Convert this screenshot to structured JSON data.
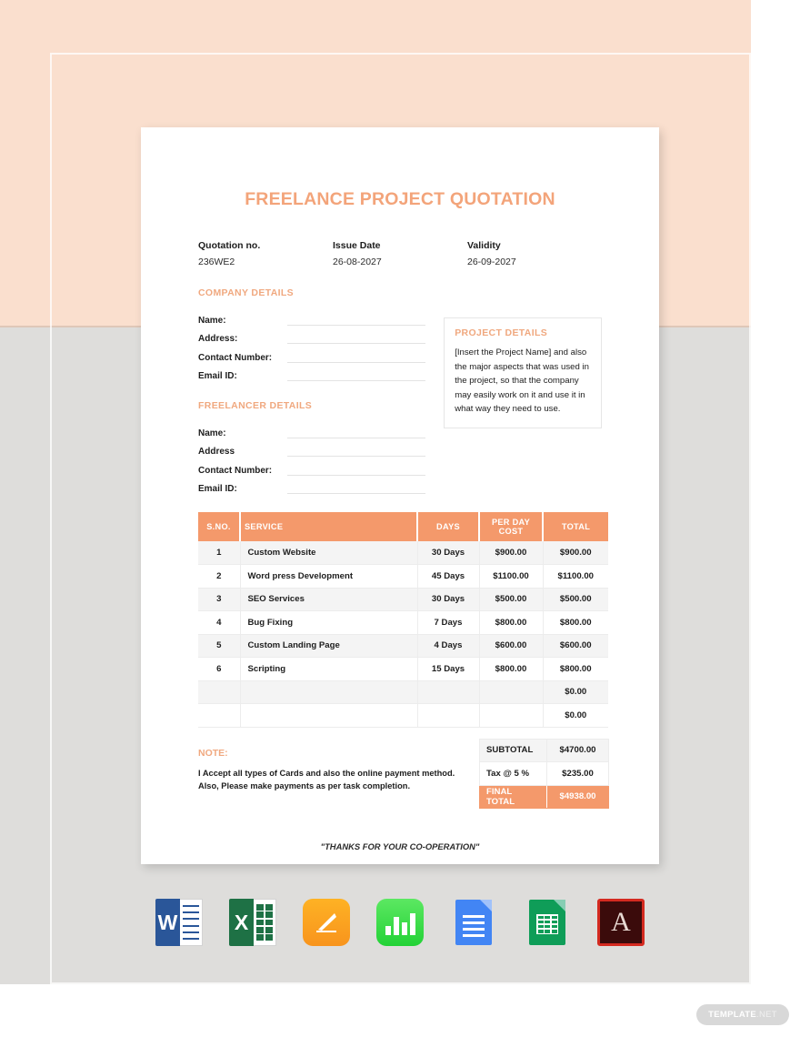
{
  "document": {
    "title": "FREELANCE PROJECT QUOTATION",
    "meta": [
      {
        "label": "Quotation no.",
        "value": "236WE2"
      },
      {
        "label": "Issue Date",
        "value": "26-08-2027"
      },
      {
        "label": "Validity",
        "value": "26-09-2027"
      }
    ],
    "company_details": {
      "title": "COMPANY DETAILS",
      "fields": [
        {
          "label": "Name:",
          "value": ""
        },
        {
          "label": "Address:",
          "value": ""
        },
        {
          "label": "Contact Number:",
          "value": ""
        },
        {
          "label": "Email ID:",
          "value": ""
        }
      ]
    },
    "freelancer_details": {
      "title": "FREELANCER DETAILS",
      "fields": [
        {
          "label": "Name:",
          "value": ""
        },
        {
          "label": "Address",
          "value": ""
        },
        {
          "label": "Contact Number:",
          "value": ""
        },
        {
          "label": "Email ID:",
          "value": ""
        }
      ]
    },
    "project_details": {
      "title": "PROJECT DETAILS",
      "text": "[Insert the Project Name] and also the major aspects that was used in the project, so that the company may easily work on it and use it in what way they need to use."
    },
    "items_table": {
      "headers": {
        "sno": "S.NO.",
        "service": "SERVICE",
        "days": "DAYS",
        "cost_line1": "PER DAY",
        "cost_line2": "COST",
        "total": "TOTAL"
      },
      "rows": [
        {
          "sno": "1",
          "service": "Custom Website",
          "days": "30 Days",
          "cost": "$900.00",
          "total": "$900.00"
        },
        {
          "sno": "2",
          "service": "Word press Development",
          "days": "45 Days",
          "cost": "$1100.00",
          "total": "$1100.00"
        },
        {
          "sno": "3",
          "service": "SEO Services",
          "days": "30 Days",
          "cost": "$500.00",
          "total": "$500.00"
        },
        {
          "sno": "4",
          "service": "Bug Fixing",
          "days": "7 Days",
          "cost": "$800.00",
          "total": "$800.00"
        },
        {
          "sno": "5",
          "service": "Custom Landing Page",
          "days": "4 Days",
          "cost": "$600.00",
          "total": "$600.00"
        },
        {
          "sno": "6",
          "service": "Scripting",
          "days": "15 Days",
          "cost": "$800.00",
          "total": "$800.00"
        },
        {
          "sno": "",
          "service": "",
          "days": "",
          "cost": "",
          "total": "$0.00"
        },
        {
          "sno": "",
          "service": "",
          "days": "",
          "cost": "",
          "total": "$0.00"
        }
      ]
    },
    "note": {
      "title": "NOTE:",
      "line1": "I Accept all types of Cards and also the online payment method.",
      "line2": "Also, Please make payments as per task completion."
    },
    "totals": [
      {
        "label": "SUBTOTAL",
        "value": "$4700.00"
      },
      {
        "label": "Tax @ 5 %",
        "value": "$235.00"
      },
      {
        "label": "FINAL TOTAL",
        "value": "$4938.00"
      }
    ],
    "thanks": "\"THANKS FOR YOUR CO-OPERATION\"",
    "accent_color": "#f4996b",
    "title_color": "#f3a47a"
  },
  "format_icons": [
    {
      "name": "microsoft-word",
      "letter": "W"
    },
    {
      "name": "microsoft-excel",
      "letter": "X"
    },
    {
      "name": "apple-pages",
      "letter": ""
    },
    {
      "name": "apple-numbers",
      "letter": ""
    },
    {
      "name": "google-docs",
      "letter": ""
    },
    {
      "name": "google-sheets",
      "letter": ""
    },
    {
      "name": "adobe-pdf",
      "letter": ""
    }
  ],
  "watermark": {
    "bold": "TEMPLATE",
    "light": ".NET"
  }
}
